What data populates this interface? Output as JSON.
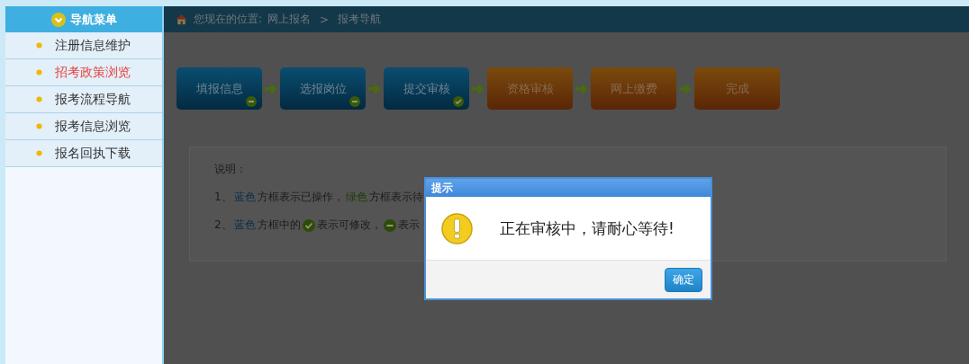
{
  "sidebar": {
    "title": "导航菜单",
    "items": [
      {
        "label": "注册信息维护",
        "selected": false
      },
      {
        "label": "招考政策浏览",
        "selected": true
      },
      {
        "label": "报考流程导航",
        "selected": false
      },
      {
        "label": "报考信息浏览",
        "selected": false
      },
      {
        "label": "报名回执下载",
        "selected": false
      }
    ]
  },
  "breadcrumb": {
    "prefix": "您现在的位置:",
    "items": [
      "网上报名",
      "报考导航"
    ],
    "separator": ">"
  },
  "steps": [
    {
      "label": "填报信息",
      "kind": "done",
      "editable": false
    },
    {
      "label": "选报岗位",
      "kind": "done",
      "editable": false
    },
    {
      "label": "提交审核",
      "kind": "done",
      "editable": true
    },
    {
      "label": "资格审核",
      "kind": "pending"
    },
    {
      "label": "网上缴费",
      "kind": "pending"
    },
    {
      "label": "完成",
      "kind": "pending"
    }
  ],
  "notes": {
    "heading": "说明：",
    "lines": [
      [
        {
          "kind": "text",
          "text": "1、"
        },
        {
          "kind": "blue",
          "text": "蓝色"
        },
        {
          "kind": "text",
          "text": "方框表示已操作，"
        },
        {
          "kind": "green",
          "text": "绿色"
        },
        {
          "kind": "text",
          "text": "方框表示待"
        }
      ],
      [
        {
          "kind": "text",
          "text": "2、"
        },
        {
          "kind": "blue",
          "text": "蓝色"
        },
        {
          "kind": "text",
          "text": "方框中的"
        },
        {
          "kind": "check"
        },
        {
          "kind": "text",
          "text": "表示可修改，"
        },
        {
          "kind": "minus"
        },
        {
          "kind": "text",
          "text": "表示"
        }
      ]
    ]
  },
  "dialog": {
    "title": "提示",
    "message": "正在审核中，请耐心等待!",
    "button": "确定"
  }
}
